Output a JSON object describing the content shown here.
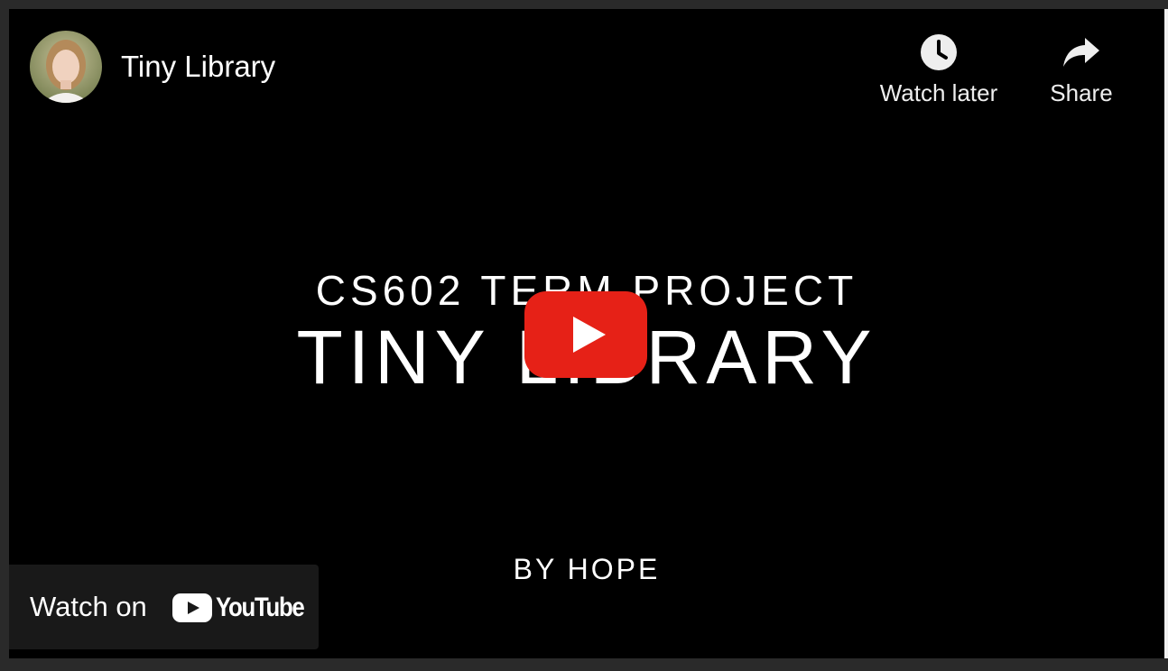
{
  "channel": {
    "title": "Tiny Library",
    "avatar_icon": "avatar"
  },
  "actions": {
    "watch_later_label": "Watch later",
    "watch_later_icon": "clock-icon",
    "share_label": "Share",
    "share_icon": "share-arrow-icon"
  },
  "video_frame": {
    "title_line1": "CS602 TERM PROJECT",
    "title_line2": "TINY LIBRARY",
    "byline": "BY HOPE"
  },
  "play_button": {
    "icon": "play-icon",
    "color": "#e62117"
  },
  "watch_on": {
    "label": "Watch on",
    "brand": "YouTube",
    "brand_icon": "youtube-logo-icon"
  }
}
